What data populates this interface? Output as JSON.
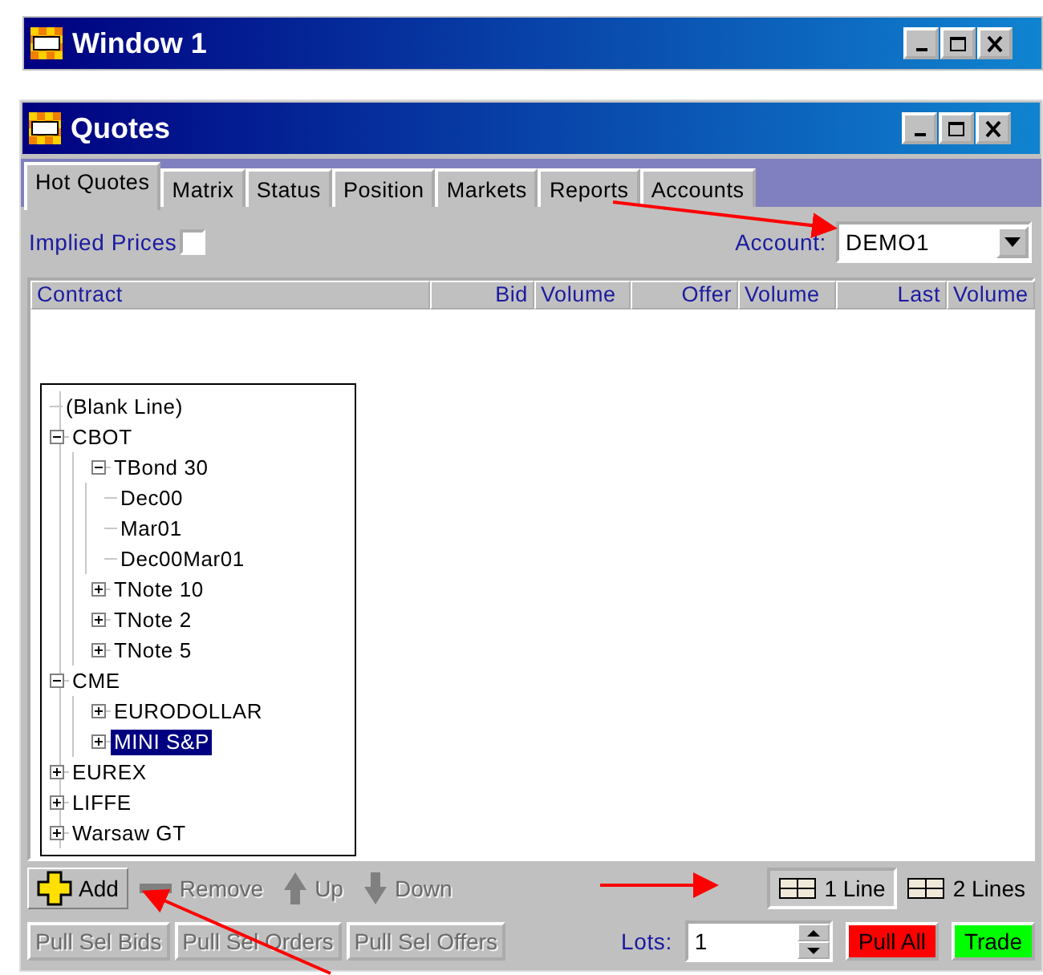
{
  "back_window": {
    "title": "Window 1"
  },
  "window": {
    "title": "Quotes"
  },
  "tabs": [
    {
      "label": "Hot Quotes",
      "selected": true
    },
    {
      "label": "Matrix",
      "selected": false
    },
    {
      "label": "Status",
      "selected": false
    },
    {
      "label": "Position",
      "selected": false
    },
    {
      "label": "Markets",
      "selected": false
    },
    {
      "label": "Reports",
      "selected": false
    },
    {
      "label": "Accounts",
      "selected": false
    }
  ],
  "implied_prices": {
    "label": "Implied Prices",
    "checked": false
  },
  "account": {
    "label": "Account:",
    "value": "DEMO1"
  },
  "table": {
    "columns": [
      {
        "label": "Contract",
        "kind": "text"
      },
      {
        "label": "Bid",
        "kind": "price"
      },
      {
        "label": "Volume",
        "kind": "volume"
      },
      {
        "label": "Offer",
        "kind": "price"
      },
      {
        "label": "Volume",
        "kind": "volume"
      },
      {
        "label": "Last",
        "kind": "price"
      },
      {
        "label": "Volume",
        "kind": "volume"
      }
    ]
  },
  "tree": [
    {
      "label": "(Blank Line)",
      "kind": "leaf",
      "selected": false
    },
    {
      "label": "CBOT",
      "kind": "node",
      "expanded": true,
      "selected": false,
      "children": [
        {
          "label": "TBond 30",
          "kind": "node",
          "expanded": true,
          "selected": false,
          "children": [
            {
              "label": "Dec00",
              "kind": "leaf",
              "selected": false
            },
            {
              "label": "Mar01",
              "kind": "leaf",
              "selected": false
            },
            {
              "label": "Dec00Mar01",
              "kind": "leaf",
              "selected": false
            }
          ]
        },
        {
          "label": "TNote 10",
          "kind": "node",
          "expanded": false,
          "selected": false
        },
        {
          "label": "TNote 2",
          "kind": "node",
          "expanded": false,
          "selected": false
        },
        {
          "label": "TNote 5",
          "kind": "node",
          "expanded": false,
          "selected": false
        }
      ]
    },
    {
      "label": "CME",
      "kind": "node",
      "expanded": true,
      "selected": false,
      "children": [
        {
          "label": "EURODOLLAR",
          "kind": "node",
          "expanded": false,
          "selected": false
        },
        {
          "label": "MINI S&P",
          "kind": "node",
          "expanded": false,
          "selected": true
        }
      ]
    },
    {
      "label": "EUREX",
      "kind": "node",
      "expanded": false,
      "selected": false
    },
    {
      "label": "LIFFE",
      "kind": "node",
      "expanded": false,
      "selected": false
    },
    {
      "label": "Warsaw GT",
      "kind": "node",
      "expanded": false,
      "selected": false
    }
  ],
  "toolbar": [
    {
      "label": "Add",
      "kind": "add",
      "disabled": false
    },
    {
      "label": "Remove",
      "kind": "remove",
      "disabled": true
    },
    {
      "label": "Up",
      "kind": "up",
      "disabled": true
    },
    {
      "label": "Down",
      "kind": "down",
      "disabled": true
    }
  ],
  "line_modes": [
    {
      "label": "1 Line",
      "selected": true
    },
    {
      "label": "2 Lines",
      "selected": false
    }
  ],
  "pull_buttons": [
    {
      "label": "Pull Sel Bids",
      "disabled": true
    },
    {
      "label": "Pull Sel Orders",
      "disabled": true
    },
    {
      "label": "Pull Sel Offers",
      "disabled": true
    }
  ],
  "lots": {
    "label": "Lots:",
    "value": "1"
  },
  "action_buttons": [
    {
      "label": "Pull All",
      "color": "#ff0000"
    },
    {
      "label": "Trade",
      "color": "#00ff00"
    }
  ]
}
